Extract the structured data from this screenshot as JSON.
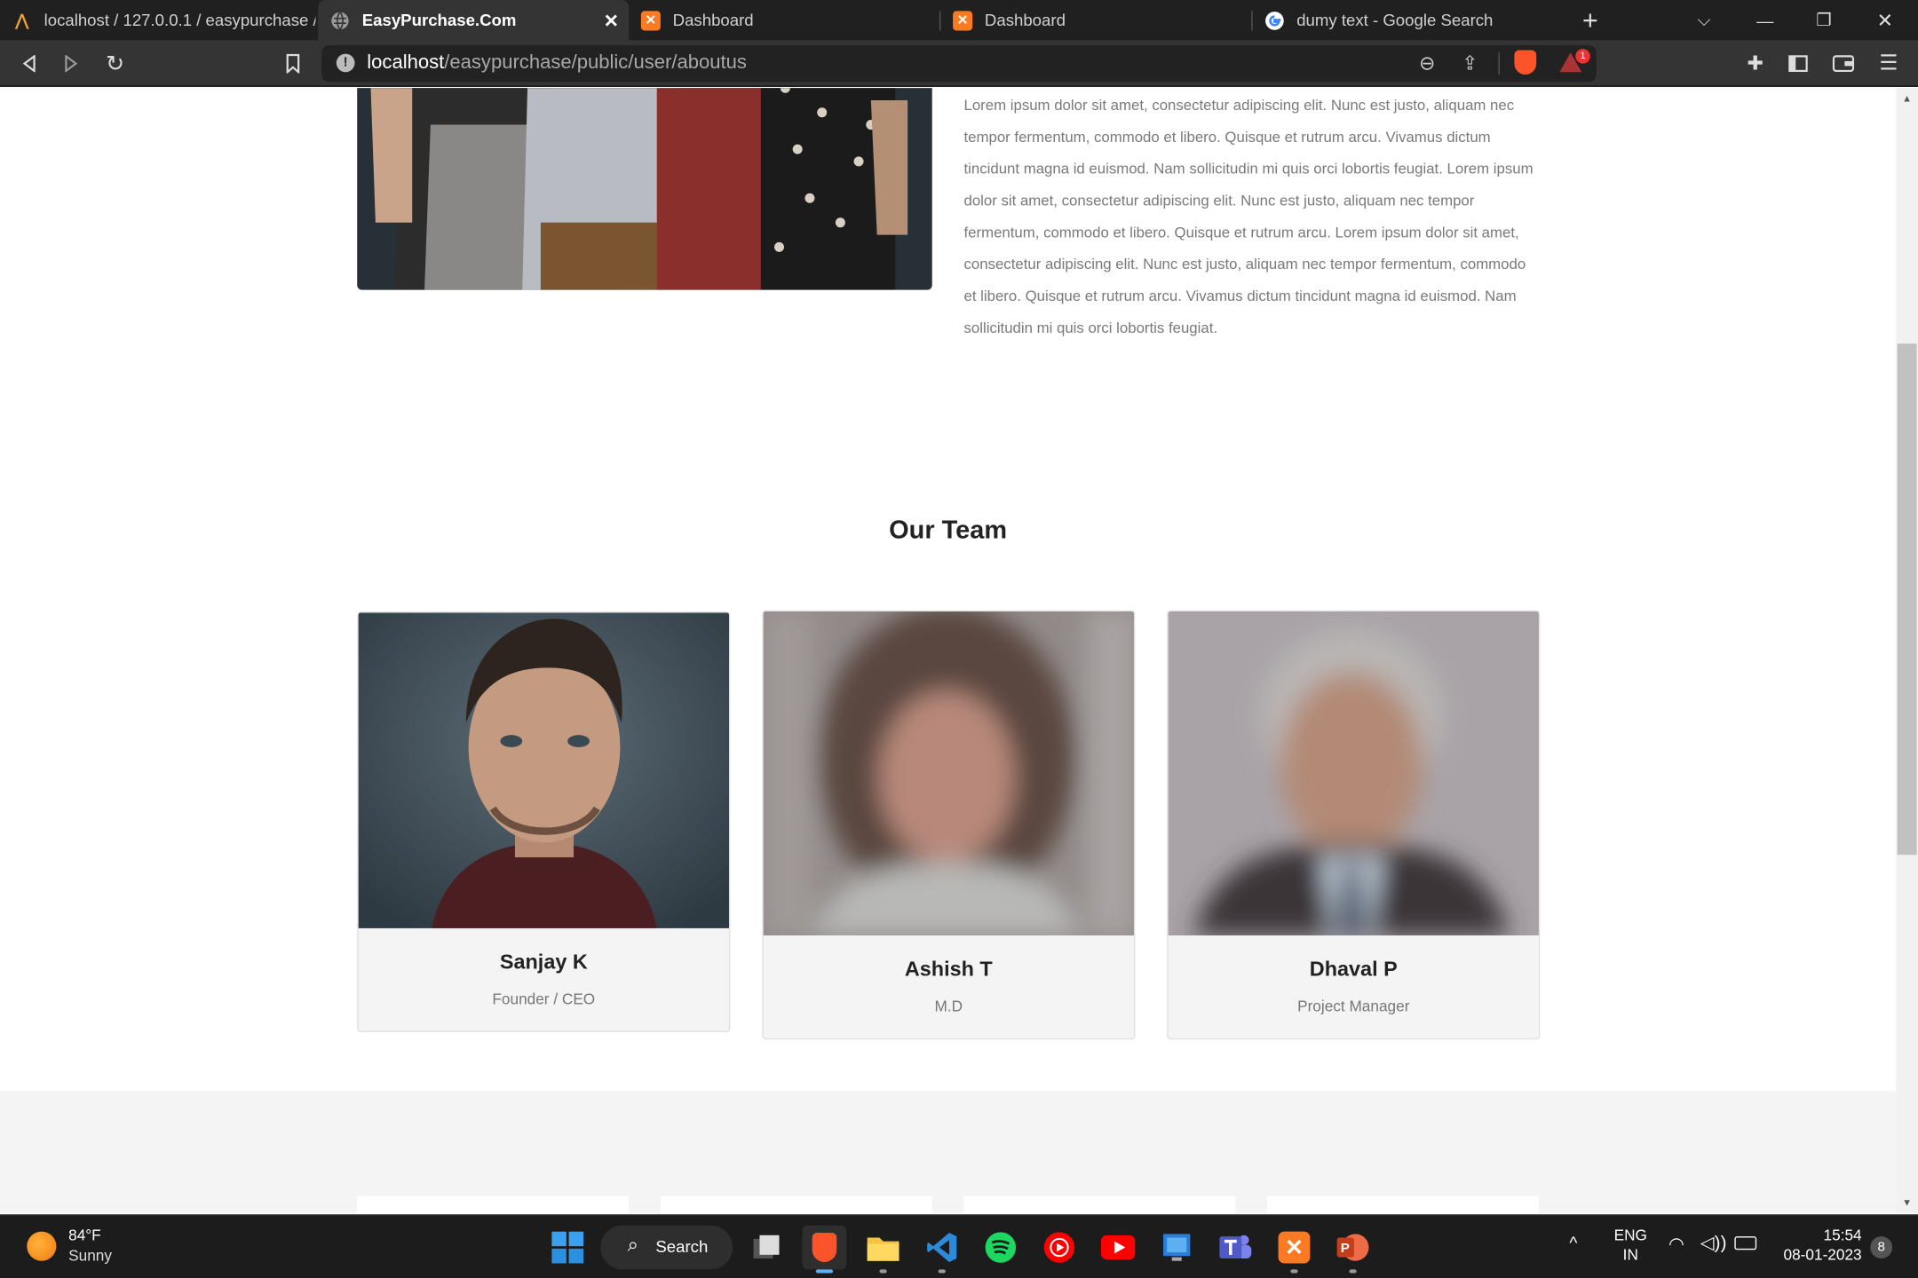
{
  "browser": {
    "tabs": [
      {
        "title": "localhost / 127.0.0.1 / easypurchase /",
        "icon": "phpmyadmin-icon"
      },
      {
        "title": "EasyPurchase.Com",
        "icon": "globe-icon",
        "active": true
      },
      {
        "title": "Dashboard",
        "icon": "xampp-icon"
      },
      {
        "title": "Dashboard",
        "icon": "xampp-icon"
      },
      {
        "title": "dumy text - Google Search",
        "icon": "google-icon"
      }
    ],
    "url_host": "localhost",
    "url_path": "/easypurchase/public/user/aboutus",
    "notification_count": "1"
  },
  "about": {
    "paragraph": "Lorem ipsum dolor sit amet, consectetur adipiscing elit. Nunc est justo, aliquam nec tempor fermentum, commodo et libero. Quisque et rutrum arcu. Vivamus dictum tincidunt magna id euismod. Nam sollicitudin mi quis orci lobortis feugiat. Lorem ipsum dolor sit amet, consectetur adipiscing elit. Nunc est justo, aliquam nec tempor fermentum, commodo et libero. Quisque et rutrum arcu. Lorem ipsum dolor sit amet, consectetur adipiscing elit. Nunc est justo, aliquam nec tempor fermentum, commodo et libero. Quisque et rutrum arcu. Vivamus dictum tincidunt magna id euismod. Nam sollicitudin mi quis orci lobortis feugiat."
  },
  "team": {
    "title": "Our Team",
    "members": [
      {
        "name": "Sanjay K",
        "role": "Founder / CEO"
      },
      {
        "name": "Ashish T",
        "role": "M.D"
      },
      {
        "name": "Dhaval P",
        "role": "Project Manager"
      }
    ]
  },
  "taskbar": {
    "weather_temp": "84°F",
    "weather_desc": "Sunny",
    "search_label": "Search",
    "lang": "ENG",
    "region": "IN",
    "time": "15:54",
    "date": "08-01-2023",
    "notif_count": "8"
  },
  "colors": {
    "accent": "#f07b3f",
    "brave": "#fb542b",
    "xampp": "#fb7a24"
  }
}
